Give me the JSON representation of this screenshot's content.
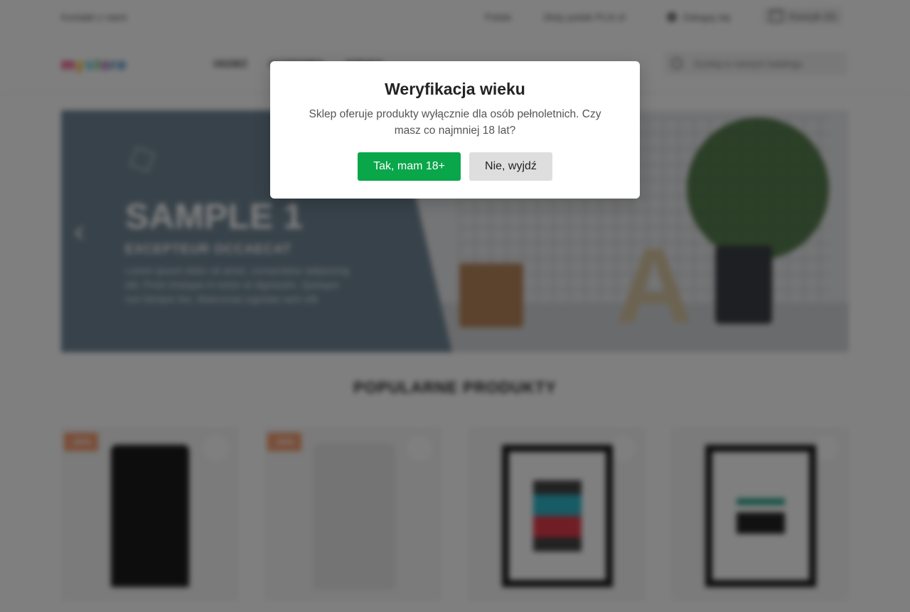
{
  "topbar": {
    "contact": "Kontakt z nami",
    "language": "Polski",
    "currency": "Złoty polski PLN zł",
    "login": "Zaloguj się",
    "cart": "Koszyk (0)"
  },
  "header": {
    "logo_letters": [
      "m",
      "y",
      "s",
      "t",
      "o",
      "re"
    ],
    "nav": [
      "ODZIEŻ",
      "AKCESORIA",
      "SZTUKA"
    ],
    "search_placeholder": "Szukaj w naszym katalogu"
  },
  "slider": {
    "title": "SAMPLE 1",
    "subtitle": "EXCEPTEUR OCCAECAT",
    "text": "Lorem ipsum dolor sit amet, consectetur adipiscing elit. Proin tristique in tortor et dignissim. Quisque non tempor leo. Maecenas egestas sem elit"
  },
  "section": {
    "title": "POPULARNE PRODUKTY"
  },
  "products": [
    {
      "badge": "-20%",
      "kind": "tshirt-black"
    },
    {
      "badge": "-20%",
      "kind": "tshirt-white"
    },
    {
      "badge": "",
      "kind": "frame-colorful"
    },
    {
      "badge": "",
      "kind": "frame-teal"
    }
  ],
  "icons": {
    "user": "user-icon",
    "cart": "cart-icon",
    "search": "search-icon",
    "slider_prev": "chevron-left-icon",
    "wishlist": "heart-icon"
  },
  "modal": {
    "title": "Weryfikacja wieku",
    "text": "Sklep oferuje produkty wyłącznie dla osób pełnoletnich. Czy masz co najmniej 18 lat?",
    "confirm_label": "Tak, mam 18+",
    "decline_label": "Nie, wyjdź"
  },
  "colors": {
    "confirm": "#0aa64a",
    "decline": "#dedede",
    "overlay": "rgba(0,0,0,0.5)",
    "badge": "#f39d72"
  }
}
